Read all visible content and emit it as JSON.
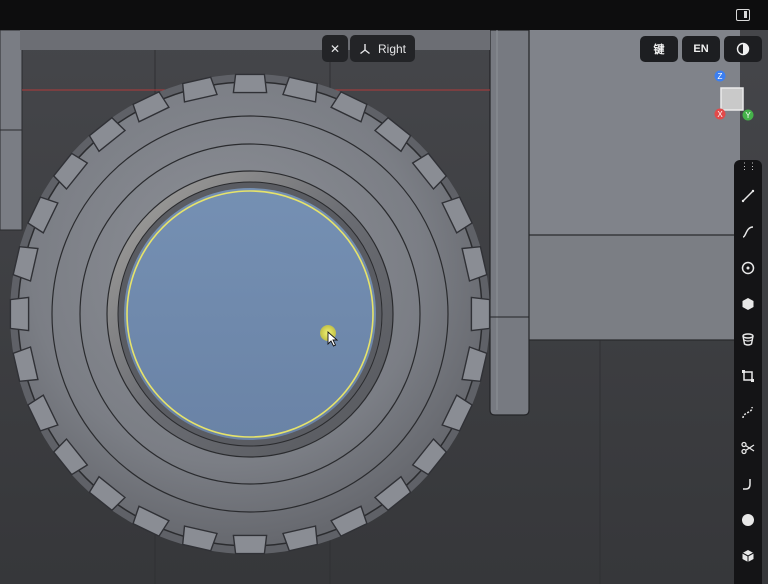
{
  "window": {
    "panel_toggle_icon": "panel-toggle-icon"
  },
  "viewport": {
    "close_icon": "close-icon",
    "view_axes_icon": "view-axes-icon",
    "view_name": "Right",
    "right_tools": [
      {
        "name": "keyboard-shortcut-button",
        "label": "键"
      },
      {
        "name": "language-button",
        "label": "EN"
      },
      {
        "name": "shading-mode-button",
        "icon": "shading-icon"
      }
    ],
    "gizmo": {
      "z": "Z",
      "x": "X",
      "y": "Y",
      "colors": {
        "z": "#3c7ff0",
        "x": "#e24a4a",
        "y": "#45b24a"
      }
    }
  },
  "toolbar": {
    "handle": "⋮⋮",
    "tools": [
      {
        "name": "line-tool",
        "icon": "line-icon"
      },
      {
        "name": "curve-tool",
        "icon": "curve-icon"
      },
      {
        "name": "circle-tool",
        "icon": "circle-icon"
      },
      {
        "name": "polygon-tool",
        "icon": "hexagon-icon"
      },
      {
        "name": "extrude-tool",
        "icon": "extrude-icon"
      },
      {
        "name": "offset-tool",
        "icon": "offset-square-icon"
      },
      {
        "name": "spline-tool",
        "icon": "spline-icon"
      },
      {
        "name": "trim-tool",
        "icon": "scissors-icon"
      },
      {
        "name": "fillet-tool",
        "icon": "fillet-icon"
      },
      {
        "name": "sphere-tool",
        "icon": "sphere-icon"
      },
      {
        "name": "box-tool",
        "icon": "cube-icon"
      }
    ]
  },
  "colors": {
    "selection_highlight": "#e6e36a",
    "tyre_face": "#7c7f86",
    "rim_fill": "#6f88ab",
    "background": "#3a3b3f"
  }
}
